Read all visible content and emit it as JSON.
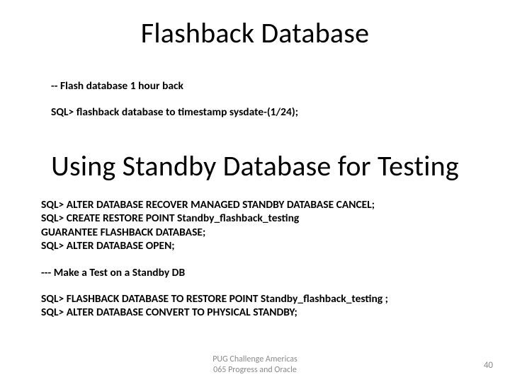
{
  "title1": "Flashback Database",
  "section1": {
    "comment": "-- Flash database 1 hour back",
    "cmd": "SQL> flashback database to timestamp sysdate-(1/24);"
  },
  "title2": "Using Standby Database for Testing",
  "section2": {
    "l1": "SQL> ALTER DATABASE RECOVER MANAGED STANDBY DATABASE CANCEL;",
    "l2": "SQL> CREATE RESTORE POINT Standby_flashback_testing",
    "l3": "GUARANTEE FLASHBACK DATABASE;",
    "l4": "SQL> ALTER DATABASE OPEN;",
    "comment": "--- Make a Test on a Standby DB",
    "l5": "SQL> FLASHBACK DATABASE TO RESTORE POINT Standby_flashback_testing ;",
    "l6": "SQL> ALTER DATABASE CONVERT TO PHYSICAL STANDBY;"
  },
  "footer": {
    "line1": "PUG Challenge Americas",
    "line2": "065 Progress and Oracle"
  },
  "page": "40"
}
